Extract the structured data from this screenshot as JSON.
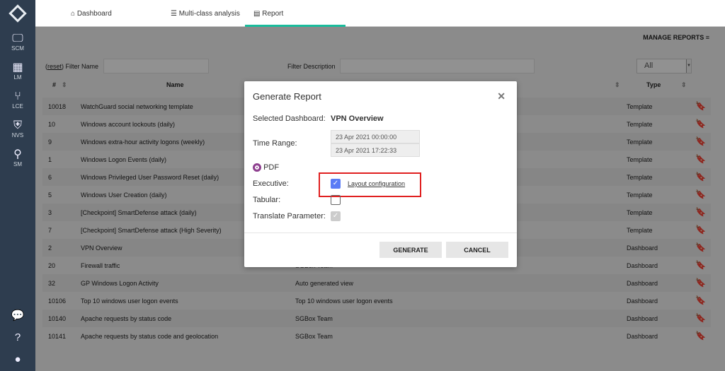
{
  "sidebar": {
    "items": [
      {
        "label": "SCM",
        "icon": "monitor-icon"
      },
      {
        "label": "LM",
        "icon": "archive-icon"
      },
      {
        "label": "LCE",
        "icon": "branch-icon"
      },
      {
        "label": "NVS",
        "icon": "shield-icon"
      },
      {
        "label": "SM",
        "icon": "search-icon"
      }
    ],
    "bottom": [
      "chat-icon",
      "help-icon",
      "user-icon"
    ]
  },
  "tabs": [
    {
      "label": "Dashboard",
      "icon": "⌂"
    },
    {
      "label": "Multi-class analysis",
      "icon": "☰"
    },
    {
      "label": "Report",
      "icon": "▤",
      "active": true
    }
  ],
  "manage_reports": "MANAGE REPORTS ≡",
  "filters": {
    "reset": "reset",
    "filter_name": "Filter Name",
    "filter_description": "Filter Description",
    "type_select": "All"
  },
  "table": {
    "headers": {
      "num": "#",
      "name": "Name",
      "type": "Type"
    },
    "rows": [
      [
        "10018",
        "WatchGuard social networking template",
        "",
        "Template"
      ],
      [
        "10",
        "Windows account lockouts (daily)",
        "",
        "Template"
      ],
      [
        "9",
        "Windows extra-hour activity logons (weekly)",
        "",
        "Template"
      ],
      [
        "1",
        "Windows Logon Events (daily)",
        "",
        "Template"
      ],
      [
        "6",
        "Windows Privileged User Password Reset (daily)",
        "",
        "Template"
      ],
      [
        "5",
        "Windows User Creation (daily)",
        "",
        "Template"
      ],
      [
        "3",
        "[Checkpoint] SmartDefense attack (daily)",
        "",
        "Template"
      ],
      [
        "7",
        "[Checkpoint] SmartDefense attack (High Severity)",
        "",
        "Template"
      ],
      [
        "2",
        "VPN Overview",
        "",
        "Dashboard"
      ],
      [
        "20",
        "Firewall traffic",
        "SGBox Team",
        "Dashboard"
      ],
      [
        "32",
        "GP Windows Logon Activity",
        "Auto generated view",
        "Dashboard"
      ],
      [
        "10106",
        "Top 10 windows user logon events",
        "Top 10 windows user logon events",
        "Dashboard"
      ],
      [
        "10140",
        "Apache requests by status code",
        "SGBox Team",
        "Dashboard"
      ],
      [
        "10141",
        "Apache requests by status code and geolocation",
        "SGBox Team",
        "Dashboard"
      ]
    ]
  },
  "modal": {
    "title": "Generate Report",
    "selected_label": "Selected Dashboard:",
    "selected_value": "VPN Overview",
    "time_label": "Time Range:",
    "time_from": "23 Apr 2021 00:00:00",
    "time_to": "23 Apr 2021 17:22:33",
    "pdf": "PDF",
    "executive": "Executive:",
    "executive_checked": true,
    "layout_link": "Layout configuration",
    "tabular": "Tabular:",
    "tabular_checked": false,
    "translate": "Translate Parameter:",
    "translate_checked": true,
    "generate": "GENERATE",
    "cancel": "CANCEL"
  },
  "colors": {
    "sidebar": "#2e3d4f",
    "accent": "#1abc9c",
    "checkbox": "#5b7cf5",
    "highlight": "#e02020",
    "radio": "#8e3f8f"
  }
}
